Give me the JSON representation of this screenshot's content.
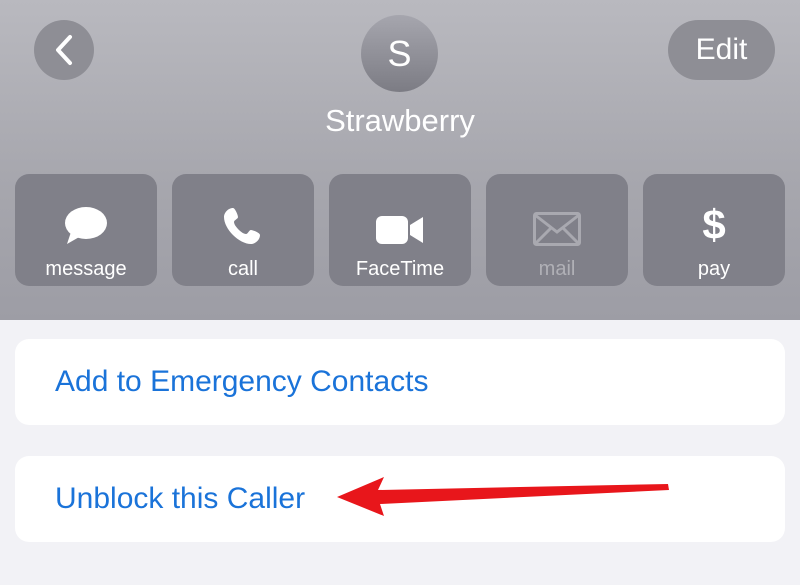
{
  "header": {
    "edit_label": "Edit",
    "avatar_initial": "S",
    "contact_name": "Strawberry"
  },
  "actions": [
    {
      "label": "message",
      "icon": "message-bubble-icon",
      "enabled": true
    },
    {
      "label": "call",
      "icon": "phone-icon",
      "enabled": true
    },
    {
      "label": "FaceTime",
      "icon": "video-camera-icon",
      "enabled": true
    },
    {
      "label": "mail",
      "icon": "envelope-icon",
      "enabled": false
    },
    {
      "label": "pay",
      "icon": "dollar-icon",
      "glyph": "$",
      "enabled": true
    }
  ],
  "cards": {
    "emergency_label": "Add to Emergency Contacts",
    "unblock_label": "Unblock this Caller"
  },
  "colors": {
    "link_blue": "#1a73d9",
    "annotation_red": "#e8161b",
    "tile_gray": "#808089"
  }
}
